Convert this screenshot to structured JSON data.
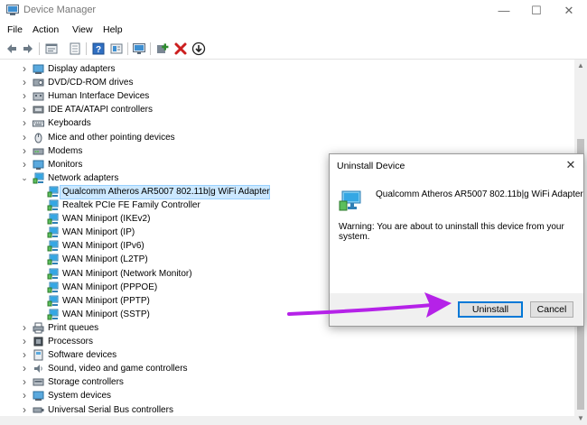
{
  "window": {
    "title": "Device Manager",
    "controls": {
      "minimize": "—",
      "maximize": "☐",
      "close": "✕"
    }
  },
  "menu": [
    "File",
    "Action",
    "View",
    "Help"
  ],
  "toolbar": {
    "icons": [
      "back-arrow-icon",
      "forward-arrow-icon",
      "properties-icon",
      "show-hidden-icon",
      "help-icon",
      "action-view-icon",
      "monitor-scan-icon",
      "add-driver-icon",
      "uninstall-x-icon",
      "update-driver-icon"
    ],
    "colors": {
      "uninstall": "#cc1f1f",
      "add": "#2e8b2e",
      "accent": "#0078d7"
    }
  },
  "tree": {
    "categories_before": [
      {
        "label": "Display adapters",
        "icon": "display-adapter-icon"
      },
      {
        "label": "DVD/CD-ROM drives",
        "icon": "dvd-drive-icon"
      },
      {
        "label": "Human Interface Devices",
        "icon": "hid-icon"
      },
      {
        "label": "IDE ATA/ATAPI controllers",
        "icon": "ide-controller-icon"
      },
      {
        "label": "Keyboards",
        "icon": "keyboard-icon"
      },
      {
        "label": "Mice and other pointing devices",
        "icon": "mouse-icon"
      },
      {
        "label": "Modems",
        "icon": "modem-icon"
      },
      {
        "label": "Monitors",
        "icon": "monitor-icon"
      }
    ],
    "expanded": {
      "label": "Network adapters",
      "icon": "network-adapter-icon"
    },
    "network_children": [
      "Qualcomm Atheros AR5007 802.11b|g WiFi Adapter",
      "Realtek PCIe FE Family Controller",
      "WAN Miniport (IKEv2)",
      "WAN Miniport (IP)",
      "WAN Miniport (IPv6)",
      "WAN Miniport (L2TP)",
      "WAN Miniport (Network Monitor)",
      "WAN Miniport (PPPOE)",
      "WAN Miniport (PPTP)",
      "WAN Miniport (SSTP)"
    ],
    "categories_after": [
      {
        "label": "Print queues",
        "icon": "printer-icon"
      },
      {
        "label": "Processors",
        "icon": "processor-icon"
      },
      {
        "label": "Software devices",
        "icon": "software-device-icon"
      },
      {
        "label": "Sound, video and game controllers",
        "icon": "speaker-icon"
      },
      {
        "label": "Storage controllers",
        "icon": "storage-icon"
      },
      {
        "label": "System devices",
        "icon": "system-device-icon"
      },
      {
        "label": "Universal Serial Bus controllers",
        "icon": "usb-icon"
      }
    ],
    "selected_index": 0
  },
  "dialog": {
    "title": "Uninstall Device",
    "device_name": "Qualcomm Atheros AR5007 802.11b|g WiFi Adapter",
    "warning": "Warning: You are about to uninstall this device from your system.",
    "uninstall_label": "Uninstall",
    "cancel_label": "Cancel",
    "close_glyph": "✕"
  },
  "annotation": {
    "arrow_color": "#b522e8"
  }
}
